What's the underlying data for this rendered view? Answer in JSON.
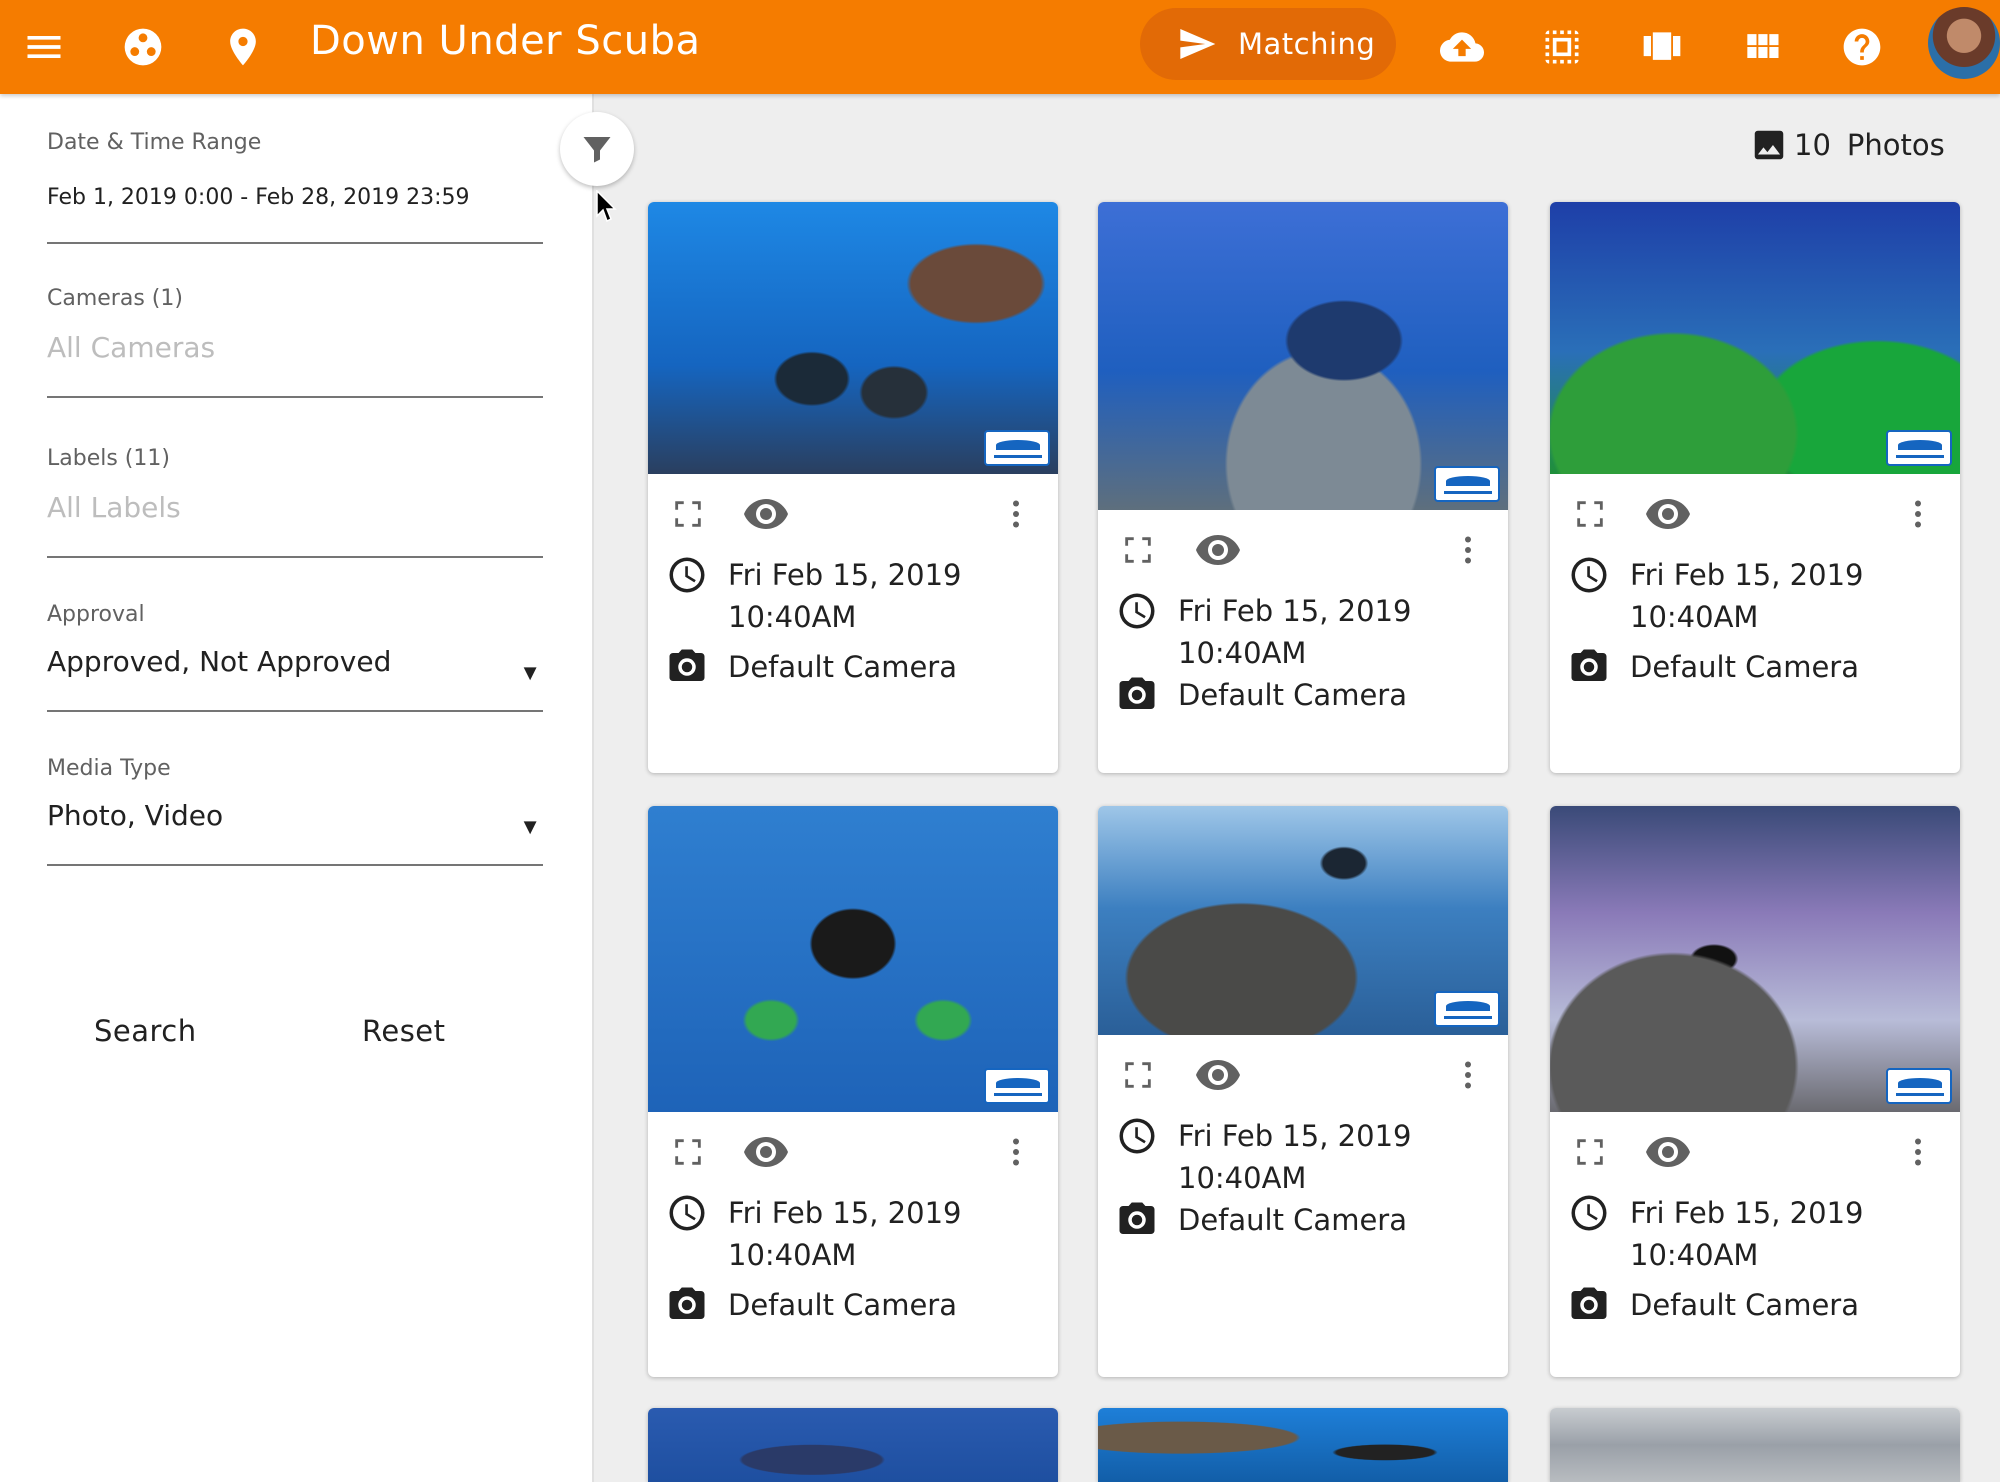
{
  "topbar": {
    "title": "Down Under Scuba",
    "matching_label": "Matching",
    "icons": [
      "menu-icon",
      "community-icon",
      "location-pin-icon",
      "send-icon",
      "cloud-upload-icon",
      "select-all-icon",
      "carousel-icon",
      "grid-view-icon",
      "help-icon",
      "avatar"
    ],
    "brand_color": "#f57c00"
  },
  "sidebar": {
    "date_range": {
      "label": "Date & Time Range",
      "value": "Feb 1, 2019 0:00 - Feb 28, 2019 23:59"
    },
    "cameras": {
      "label": "Cameras (1)",
      "placeholder": "All Cameras"
    },
    "labels": {
      "label": "Labels (11)",
      "placeholder": "All Labels"
    },
    "approval": {
      "label": "Approval",
      "value": "Approved, Not Approved"
    },
    "media_type": {
      "label": "Media Type",
      "value": "Photo, Video"
    },
    "search_label": "Search",
    "reset_label": "Reset"
  },
  "gallery": {
    "count": "10",
    "count_label": "Photos",
    "cards": [
      {
        "date": "Fri Feb 15, 2019",
        "time": "10:40AM",
        "camera": "Default Camera"
      },
      {
        "date": "Fri Feb 15, 2019",
        "time": "10:40AM",
        "camera": "Default Camera"
      },
      {
        "date": "Fri Feb 15, 2019",
        "time": "10:40AM",
        "camera": "Default Camera"
      },
      {
        "date": "Fri Feb 15, 2019",
        "time": "10:40AM",
        "camera": "Default Camera"
      },
      {
        "date": "Fri Feb 15, 2019",
        "time": "10:40AM",
        "camera": "Default Camera"
      },
      {
        "date": "Fri Feb 15, 2019",
        "time": "10:40AM",
        "camera": "Default Camera"
      }
    ]
  }
}
